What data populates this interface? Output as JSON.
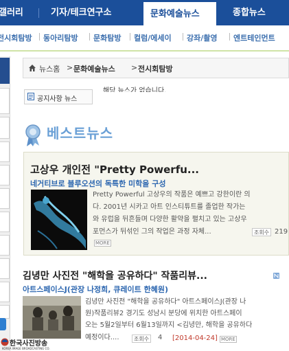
{
  "top_nav": {
    "items": [
      "갤러리",
      "기자/테크연구소",
      "문화예술뉴스",
      "종합뉴스"
    ],
    "active": "문화예술뉴스"
  },
  "sub_nav": {
    "items": [
      "전시회탐방",
      "동아리탐방",
      "문화탐방",
      "컬럼/에세이",
      "강좌/촬영",
      "엔트테인먼트"
    ]
  },
  "breadcrumb": {
    "items": [
      "뉴스홈",
      "문화예술뉴스",
      "전시회탐방"
    ],
    "separator": ">"
  },
  "notice": {
    "label": "공지사항 뉴스",
    "text": "해당 뉴스가 없습니다."
  },
  "best_news": {
    "title": "베스트뉴스"
  },
  "featured": {
    "title": "고상우 개인전 \"Pretty Powerfu...",
    "subtitle": "네거티브로 블루오션의 독특한 미학을 구성",
    "lines": [
      "Pretty Powerful 고상우의 작품은 예쁘고 강한이란 의",
      "다. 2001년 시카고 아트 인스티튜트를 졸업한 작가는",
      "와 유럽을 뒤흔들며 다양한 활약을 펼치고 있는 고상우",
      "포먼스가 뒤섞인 그의 작업은 과정 자체..."
    ],
    "hit_label": "조회수",
    "hit_value": "219",
    "more_label": "MORE"
  },
  "article2": {
    "title": "김녕만 사진전 \"해학을 공유하다\" 작품리뷰...",
    "subtitle": "아트스페이스J(관장 나정희, 큐레이트 한혜원)",
    "lines": [
      "김녕만 사진전 \"해학을 공유하다\" 아트스페이스J(관장 나",
      "원)작품리뷰2 경기도 성남시 분당에 위치한 아트스페이",
      "오는 5월2일부터 6월13일까지 <김녕만, 해학을 공유하다",
      "예정이다...."
    ],
    "hit_label": "조회수",
    "hit_value": "4",
    "date": "[2014-04-24]",
    "more_label": "MORE"
  },
  "logo": {
    "text": "한국사진방송",
    "sub": "KOREA IMAGE BROADCASTING CO."
  },
  "colors": {
    "nav_blue": "#1b4f9a",
    "link_blue": "#2d67b0",
    "accent_green": "#cfe3a6",
    "best_blue": "#6aa0d6",
    "date_red": "#c0392b"
  }
}
